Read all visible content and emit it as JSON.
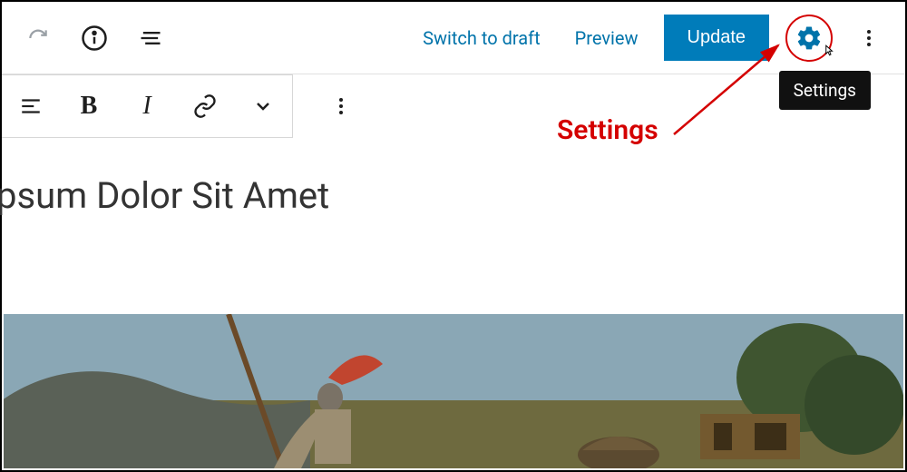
{
  "topbar": {
    "switch_to_draft": "Switch to draft",
    "preview": "Preview",
    "update": "Update"
  },
  "tooltip": {
    "settings": "Settings"
  },
  "annotation": {
    "settings": "Settings"
  },
  "post": {
    "title": "psum Dolor Sit Amet"
  }
}
